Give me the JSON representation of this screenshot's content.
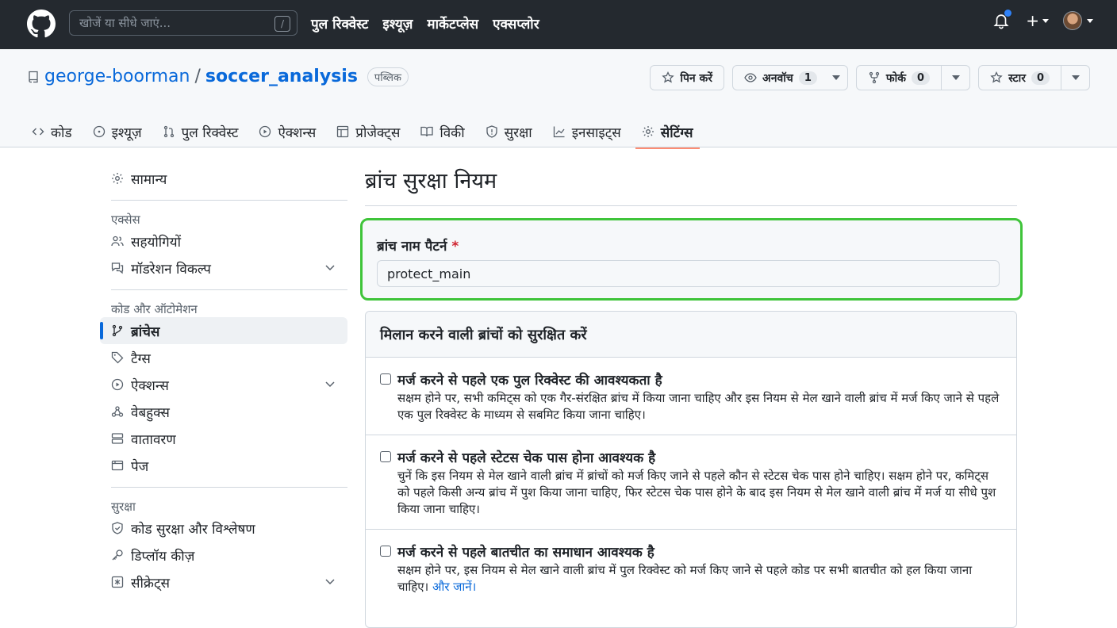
{
  "header": {
    "search_placeholder": "खोजें या सीधे जाएं...",
    "search_hint": "/",
    "nav": [
      "पुल रिक्वेस्ट",
      "इश्यूज़",
      "मार्केटप्लेस",
      "एक्सप्लोर"
    ],
    "plus_label": "+"
  },
  "repo": {
    "owner": "george-boorman",
    "separator": "/",
    "name": "soccer_analysis",
    "visibility": "पब्लिक",
    "pin_label": "पिन करें",
    "watch_label": "अनवॉच",
    "watch_count": "1",
    "fork_label": "फोर्क",
    "fork_count": "0",
    "star_label": "स्टार",
    "star_count": "0"
  },
  "tabs": [
    {
      "label": "कोड",
      "icon": "code-icon"
    },
    {
      "label": "इश्यूज़",
      "icon": "issue-icon"
    },
    {
      "label": "पुल रिक्वेस्ट",
      "icon": "pull-request-icon"
    },
    {
      "label": "ऐक्शन्स",
      "icon": "play-icon"
    },
    {
      "label": "प्रोजेक्ट्स",
      "icon": "table-icon"
    },
    {
      "label": "विकी",
      "icon": "book-icon"
    },
    {
      "label": "सुरक्षा",
      "icon": "shield-icon"
    },
    {
      "label": "इनसाइट्स",
      "icon": "graph-icon"
    },
    {
      "label": "सेटिंग्स",
      "icon": "gear-icon"
    }
  ],
  "sidebar": {
    "general": "सामान्य",
    "access_heading": "एक्सेस",
    "collaborators": "सहयोगियों",
    "moderation": "मॉडरेशन विकल्प",
    "code_heading": "कोड और ऑटोमेशन",
    "branches": "ब्रांचेस",
    "tags": "टैग्स",
    "actions": "ऐक्शन्स",
    "webhooks": "वेबहुक्स",
    "environments": "वातावरण",
    "pages": "पेज",
    "security_heading": "सुरक्षा",
    "code_security": "कोड सुरक्षा और विश्लेषण",
    "deploy_keys": "डिप्लॉय कीज़",
    "secrets": "सीक्रेट्स"
  },
  "main": {
    "title": "ब्रांच सुरक्षा नियम",
    "pattern_label": "ब्रांच नाम पैटर्न",
    "required_mark": "*",
    "pattern_value": "protect_main",
    "panel_heading": "मिलान करने वाली ब्रांचों को सुरक्षित करें",
    "rules": [
      {
        "title": "मर्ज करने से पहले एक पुल रिक्वेस्ट की आवश्यकता है",
        "desc": "सक्षम होने पर, सभी कमिट्स को एक गैर-संरक्षित ब्रांच में किया जाना चाहिए और इस नियम से मेल खाने वाली ब्रांच में मर्ज किए जाने से पहले एक पुल रिक्वेस्ट के माध्यम से सबमिट किया जाना चाहिए।"
      },
      {
        "title": "मर्ज करने से पहले स्टेटस चेक पास होना आवश्यक है",
        "desc": "चुनें कि इस नियम से मेल खाने वाली ब्रांच में ब्रांचों को मर्ज किए जाने से पहले कौन से स्टेटस चेक पास होने चाहिए। सक्षम होने पर, कमिट्स को पहले किसी अन्य ब्रांच में पुश किया जाना चाहिए, फिर स्टेटस चेक पास होने के बाद इस नियम से मेल खाने वाली ब्रांच में मर्ज या सीधे पुश किया जाना चाहिए।"
      },
      {
        "title": "मर्ज करने से पहले बातचीत का समाधान आवश्यक है",
        "desc": "सक्षम होने पर, इस नियम से मेल खाने वाली ब्रांच में पुल रिक्वेस्ट को मर्ज किए जाने से पहले कोड पर सभी बातचीत को हल किया जाना चाहिए।",
        "link": "और जानें।"
      }
    ]
  },
  "colors": {
    "accent": "#0969da",
    "highlight": "#3fc43a",
    "header_bg": "#24292f",
    "tab_underline": "#fd8c73"
  }
}
